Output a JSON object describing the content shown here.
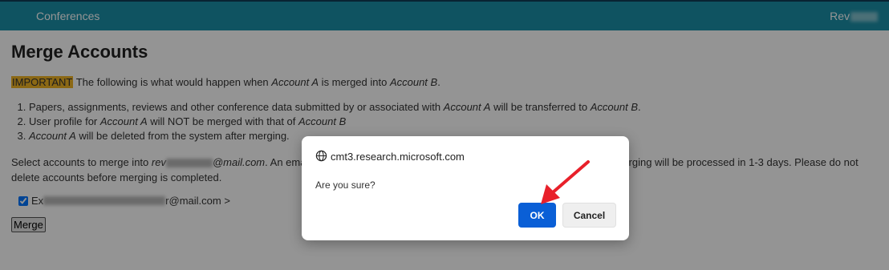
{
  "topbar": {
    "nav_conferences": "Conferences",
    "user_prefix": "Rev"
  },
  "page": {
    "title": "Merge Accounts",
    "important_label": "IMPORTANT",
    "important_text_1": " The following is what would happen when ",
    "account_a": "Account A",
    "important_text_2": " is merged into ",
    "account_b": "Account B",
    "period": ".",
    "list": {
      "item1_pre": "Papers, assignments, reviews and other conference data submitted by or associated with ",
      "item1_mid": " will be transferred to ",
      "item2_pre": "User profile for ",
      "item2_mid": " will NOT be merged with that of ",
      "item3_post": " will be deleted from the system after merging."
    },
    "select_pre": "Select accounts to merge into ",
    "select_email_prefix": "rev",
    "select_email_suffix": "@mail.com",
    "select_post_a": ". An ema",
    "select_post_b": "merging will be processed in 1-3 days. Please do not",
    "select_line2": "delete accounts before merging is completed.",
    "account_row_prefix": "Ex",
    "account_row_suffix": "r@mail.com >",
    "merge_button": "Merge"
  },
  "dialog": {
    "origin": "cmt3.research.microsoft.com",
    "message": "Are you sure?",
    "ok_label": "OK",
    "cancel_label": "Cancel",
    "ok_color": "#0a5fd6"
  },
  "colors": {
    "topbar": "#1a8fa7",
    "important_highlight": "#f0b323",
    "annotation_arrow": "#e8202a"
  }
}
